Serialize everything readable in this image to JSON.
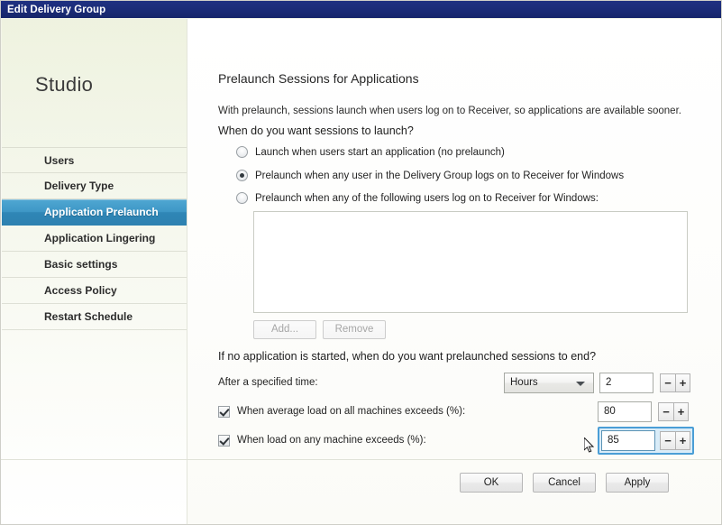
{
  "window": {
    "title": "Edit Delivery Group"
  },
  "sidebar": {
    "logo": "Studio",
    "items": [
      {
        "label": "Users",
        "selected": false
      },
      {
        "label": "Delivery Type",
        "selected": false
      },
      {
        "label": "Application Prelaunch",
        "selected": true
      },
      {
        "label": "Application Lingering",
        "selected": false
      },
      {
        "label": "Basic settings",
        "selected": false
      },
      {
        "label": "Access Policy",
        "selected": false
      },
      {
        "label": "Restart Schedule",
        "selected": false
      }
    ]
  },
  "main": {
    "page_title": "Prelaunch Sessions for Applications",
    "intro": "With prelaunch, sessions launch when users log on to Receiver, so applications are available sooner.",
    "question_launch": "When do you want sessions to launch?",
    "radios": [
      {
        "label": "Launch when users start an application (no prelaunch)",
        "checked": false
      },
      {
        "label": "Prelaunch when any user in the Delivery Group logs on to Receiver for Windows",
        "checked": true
      },
      {
        "label": "Prelaunch when any of the following users log on to Receiver for Windows:",
        "checked": false
      }
    ],
    "user_list": {
      "items": [],
      "add_label": "Add...",
      "remove_label": "Remove",
      "add_enabled": false,
      "remove_enabled": false
    },
    "question_end": "If no application is started, when do you want prelaunched sessions to end?",
    "settings": [
      {
        "label": "After a specified time:",
        "control": "select-and-spin",
        "checkbox": null,
        "select_value": "Hours",
        "value": "2",
        "focused": false
      },
      {
        "label": "When average load on all machines exceeds (%):",
        "control": "spin",
        "checkbox": true,
        "select_value": null,
        "value": "80",
        "focused": false
      },
      {
        "label": "When load on any machine exceeds (%):",
        "control": "spin",
        "checkbox": true,
        "select_value": null,
        "value": "85",
        "focused": true
      }
    ],
    "spinner": {
      "decrement": "−",
      "increment": "+"
    }
  },
  "footer": {
    "ok": "OK",
    "cancel": "Cancel",
    "apply": "Apply"
  },
  "colors": {
    "titlebar": "#1b2c78",
    "selected_nav": "#3e97c6",
    "focus_border": "#4a9ed6"
  }
}
